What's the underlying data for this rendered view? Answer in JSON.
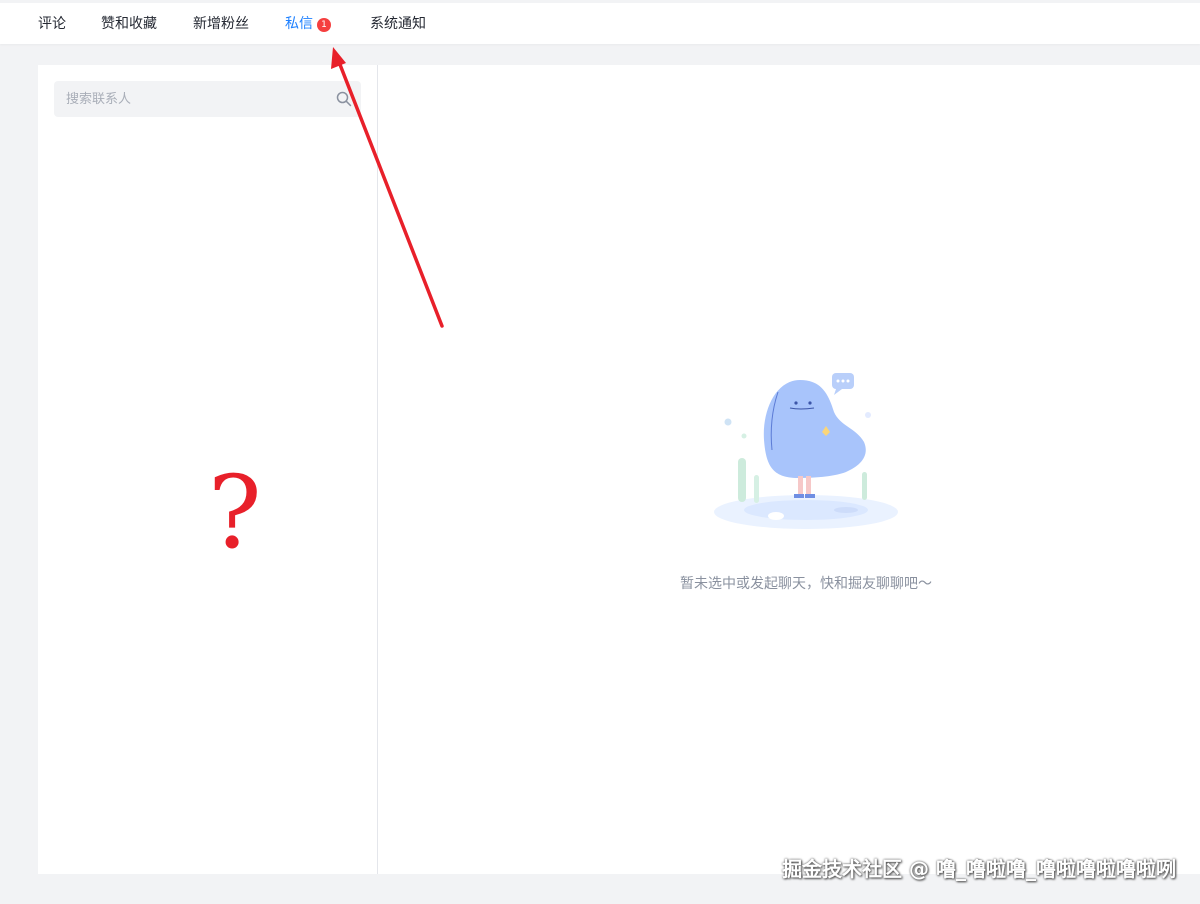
{
  "tabs": [
    {
      "label": "评论",
      "active": false
    },
    {
      "label": "赞和收藏",
      "active": false
    },
    {
      "label": "新增粉丝",
      "active": false
    },
    {
      "label": "私信",
      "active": true,
      "badge": "1"
    },
    {
      "label": "系统通知",
      "active": false
    }
  ],
  "search": {
    "placeholder": "搜索联系人",
    "value": "",
    "icon": "search-icon"
  },
  "annotation": {
    "question_mark": "?"
  },
  "empty_state": {
    "text": "暂未选中或发起聊天，快和掘友聊聊吧～"
  },
  "watermark": "掘金技术社区 @ 噜_噜啦噜_噜啦噜啦噜啦咧",
  "colors": {
    "accent": "#1e80ff",
    "badge": "#f53f3f",
    "annotation": "#e8202a"
  }
}
